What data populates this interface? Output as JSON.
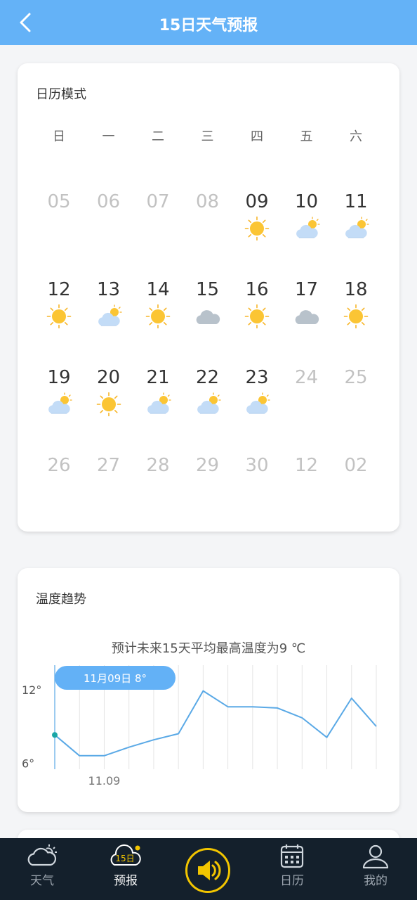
{
  "header": {
    "title": "15日天气预报"
  },
  "calendar": {
    "title": "日历模式",
    "weekdays": [
      "日",
      "一",
      "二",
      "三",
      "四",
      "五",
      "六"
    ],
    "days": [
      {
        "num": "05",
        "dim": true,
        "icon": ""
      },
      {
        "num": "06",
        "dim": true,
        "icon": ""
      },
      {
        "num": "07",
        "dim": true,
        "icon": ""
      },
      {
        "num": "08",
        "dim": true,
        "icon": ""
      },
      {
        "num": "09",
        "dim": false,
        "icon": "sunny-icon"
      },
      {
        "num": "10",
        "dim": false,
        "icon": "partly-cloudy-icon"
      },
      {
        "num": "11",
        "dim": false,
        "icon": "partly-cloudy-icon"
      },
      {
        "num": "12",
        "dim": false,
        "icon": "sunny-icon"
      },
      {
        "num": "13",
        "dim": false,
        "icon": "partly-cloudy-icon"
      },
      {
        "num": "14",
        "dim": false,
        "icon": "sunny-icon"
      },
      {
        "num": "15",
        "dim": false,
        "icon": "cloudy-icon"
      },
      {
        "num": "16",
        "dim": false,
        "icon": "sunny-icon"
      },
      {
        "num": "17",
        "dim": false,
        "icon": "cloudy-icon"
      },
      {
        "num": "18",
        "dim": false,
        "icon": "sunny-icon"
      },
      {
        "num": "19",
        "dim": false,
        "icon": "partly-cloudy-icon"
      },
      {
        "num": "20",
        "dim": false,
        "icon": "sunny-icon"
      },
      {
        "num": "21",
        "dim": false,
        "icon": "partly-cloudy-icon"
      },
      {
        "num": "22",
        "dim": false,
        "icon": "partly-cloudy-icon"
      },
      {
        "num": "23",
        "dim": false,
        "icon": "partly-cloudy-icon"
      },
      {
        "num": "24",
        "dim": true,
        "icon": ""
      },
      {
        "num": "25",
        "dim": true,
        "icon": ""
      },
      {
        "num": "26",
        "dim": true,
        "icon": ""
      },
      {
        "num": "27",
        "dim": true,
        "icon": ""
      },
      {
        "num": "28",
        "dim": true,
        "icon": ""
      },
      {
        "num": "29",
        "dim": true,
        "icon": ""
      },
      {
        "num": "30",
        "dim": true,
        "icon": ""
      },
      {
        "num": "12",
        "dim": true,
        "icon": ""
      },
      {
        "num": "02",
        "dim": true,
        "icon": ""
      }
    ]
  },
  "temperature": {
    "title": "温度趋势",
    "subtitle": "预计未来15天平均最高温度为9 ℃",
    "tooltip": "11月09日 8°"
  },
  "chart_data": {
    "type": "line",
    "series": [
      {
        "values": [
          8.3,
          6.6,
          6.6,
          7.3,
          7.9,
          8.4,
          11.9,
          10.6,
          10.6,
          10.5,
          9.7,
          8.1,
          11.3,
          9.0
        ]
      }
    ],
    "ylim": [
      5.5,
      14
    ],
    "yticks": [
      {
        "value": 6,
        "label": "6°"
      },
      {
        "value": 12,
        "label": "12°"
      }
    ],
    "xtick_labels": [
      {
        "index": 2,
        "label": "11.09"
      }
    ],
    "highlight_index": 0,
    "colors": {
      "line": "#5aa9e6",
      "highlight": "#1aa6a6",
      "tooltip_bg": "#63b1f6",
      "grid": "#e4e4e4"
    }
  },
  "nav": {
    "items": [
      {
        "label": "天气",
        "active": false
      },
      {
        "label": "预报",
        "active": true,
        "badge": "15日"
      },
      {
        "label": "日历",
        "active": false
      },
      {
        "label": "我的",
        "active": false
      }
    ]
  },
  "colors": {
    "accent": "#64b2f7",
    "nav_bg": "#14202c",
    "voice_ring": "#f2c500"
  }
}
